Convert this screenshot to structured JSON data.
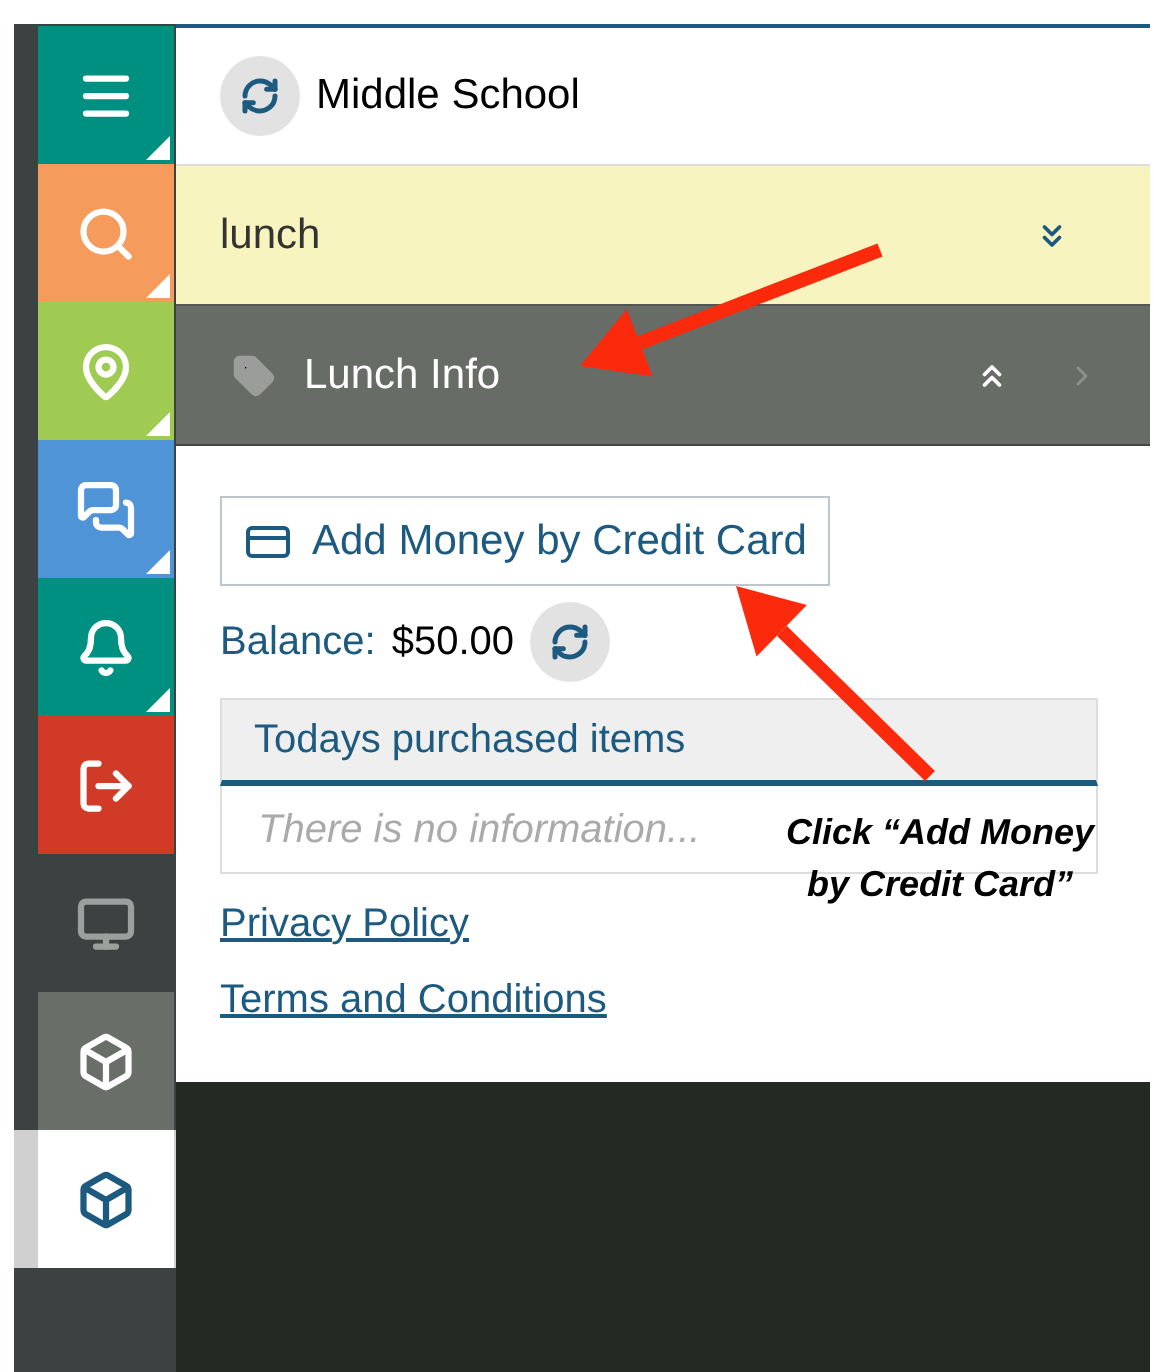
{
  "sidebar": {
    "items": [
      {
        "kind": "menu",
        "color": "#009081",
        "submenu": true,
        "selected": false
      },
      {
        "kind": "search",
        "color": "#f59b5c",
        "submenu": true,
        "selected": false
      },
      {
        "kind": "pin",
        "color": "#9fcb52",
        "submenu": true,
        "selected": false
      },
      {
        "kind": "chat",
        "color": "#4f94d6",
        "submenu": true,
        "selected": false
      },
      {
        "kind": "bell",
        "color": "#009081",
        "submenu": true,
        "selected": false
      },
      {
        "kind": "logout",
        "color": "#d13a26",
        "submenu": false,
        "selected": false
      },
      {
        "kind": "monitor",
        "color": "#3c4141",
        "submenu": false,
        "selected": false
      },
      {
        "kind": "cube",
        "color": "#6a6e69",
        "submenu": false,
        "selected": false
      },
      {
        "kind": "cube",
        "color": "#ffffff",
        "submenu": false,
        "selected": true
      }
    ]
  },
  "header": {
    "title": "Middle School"
  },
  "search": {
    "value": "lunch"
  },
  "section": {
    "title": "Lunch Info",
    "expanded": true
  },
  "content": {
    "add_money_button": "Add Money by Credit Card",
    "balance_label": "Balance:",
    "balance_value": "$50.00",
    "purchases": {
      "heading": "Todays purchased items",
      "empty_text": "There is no information..."
    },
    "links": [
      "Privacy Policy",
      "Terms and Conditions"
    ]
  },
  "annotation": {
    "text": "Click “Add Money by Credit Card”"
  }
}
